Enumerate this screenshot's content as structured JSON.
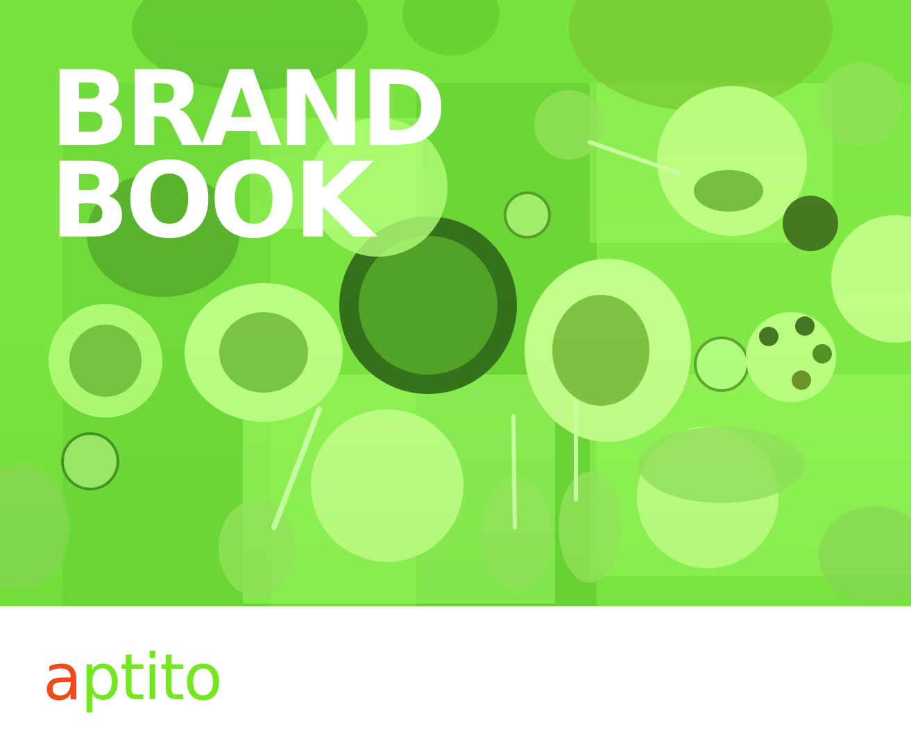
{
  "hero": {
    "title_line_1": "BRAND",
    "title_line_2": "BOOK",
    "photo": "overhead-dining-table",
    "tint_color": "#7fe844"
  },
  "footer": {
    "logo_first_letter": "a",
    "logo_rest": "ptito",
    "logo_first_color": "#f04a1a",
    "logo_rest_color": "#74e81e"
  }
}
